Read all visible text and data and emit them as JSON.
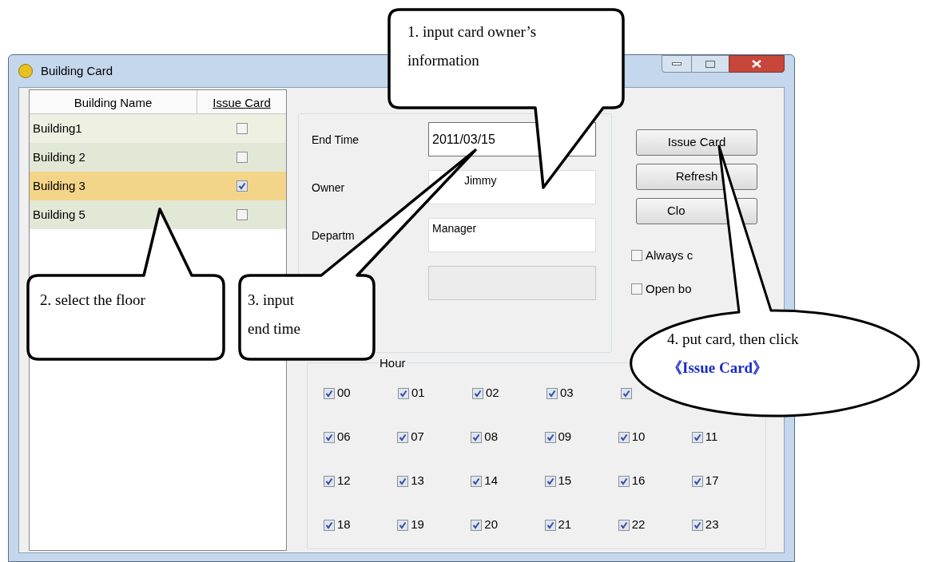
{
  "window": {
    "title": "Building Card"
  },
  "buildings": {
    "columns": [
      "Building Name",
      "Issue Card"
    ],
    "rows": [
      {
        "name": "Building1",
        "issue_card": false,
        "selected": false
      },
      {
        "name": "Building 2",
        "issue_card": false,
        "selected": false
      },
      {
        "name": "Building 3",
        "issue_card": true,
        "selected": true
      },
      {
        "name": "Building 5",
        "issue_card": false,
        "selected": false
      }
    ]
  },
  "fields": [
    {
      "label": "End Time",
      "value": "2011/03/15",
      "disabled": false
    },
    {
      "label": "Owner",
      "value": "Jimmy",
      "disabled": false
    },
    {
      "label": "Departm",
      "value": "Manager",
      "disabled": false
    },
    {
      "disabled": true
    }
  ],
  "buttons": [
    "Issue Card",
    "Refresh",
    "Clo"
  ],
  "options": [
    {
      "label": "Always c",
      "checked": false
    },
    {
      "label": "Open bo",
      "checked": false
    }
  ],
  "hours": {
    "label": "Hour",
    "rows": [
      [
        {
          "label": "00",
          "checked": true
        },
        {
          "label": "01",
          "checked": true
        },
        {
          "label": "02",
          "checked": true
        },
        {
          "label": "03",
          "checked": true
        },
        {
          "checked": true
        }
      ],
      [
        {
          "label": "06",
          "checked": true
        },
        {
          "label": "07",
          "checked": true
        },
        {
          "label": "08",
          "checked": true
        },
        {
          "label": "09",
          "checked": true
        },
        {
          "label": "10",
          "checked": true
        },
        {
          "label": "11",
          "checked": true
        }
      ],
      [
        {
          "label": "12",
          "checked": true
        },
        {
          "label": "13",
          "checked": true
        },
        {
          "label": "14",
          "checked": true
        },
        {
          "label": "15",
          "checked": true
        },
        {
          "label": "16",
          "checked": true
        },
        {
          "label": "17",
          "checked": true
        }
      ],
      [
        {
          "label": "18",
          "checked": true
        },
        {
          "label": "19",
          "checked": true
        },
        {
          "label": "20",
          "checked": true
        },
        {
          "label": "21",
          "checked": true
        },
        {
          "label": "22",
          "checked": true
        },
        {
          "label": "23",
          "checked": true
        }
      ]
    ]
  },
  "callouts": [
    {
      "kind": "box",
      "text": "1. input card owner’s information"
    },
    {
      "kind": "box",
      "text": "2. select the floor"
    },
    {
      "kind": "box",
      "text": "3. input end time"
    },
    {
      "kind": "oval",
      "text": "4. put card, then click**《Issue Card》**"
    }
  ]
}
